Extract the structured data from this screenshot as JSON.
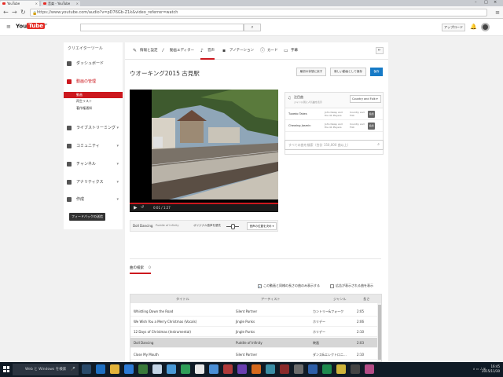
{
  "browser": {
    "tabs": [
      {
        "label": "YouTube"
      },
      {
        "label": "音楽 - YouTube"
      }
    ],
    "url": "https://www.youtube.com/audio?v=pD76Gb-Z1k&video_referrer=watch"
  },
  "header": {
    "logo_you": "You",
    "logo_tube": "Tube",
    "logo_region": "JP",
    "upload_label": "アップロード"
  },
  "sidebar": {
    "title": "クリエイターツール",
    "items": [
      {
        "label": "ダッシュボード"
      },
      {
        "label": "動画の管理"
      },
      {
        "label": "ライブストリーミング"
      },
      {
        "label": "コミュニティ"
      },
      {
        "label": "チャンネル"
      },
      {
        "label": "アナリティクス"
      },
      {
        "label": "作成"
      }
    ],
    "subitems": [
      {
        "label": "動画"
      },
      {
        "label": "再生リスト"
      },
      {
        "label": "著作権通知"
      }
    ],
    "feedback_label": "フィードバックの送信"
  },
  "editor": {
    "tabs": [
      {
        "label": "情報と設定"
      },
      {
        "label": "動画エディター"
      },
      {
        "label": "音声"
      },
      {
        "label": "アノテーション"
      },
      {
        "label": "カード"
      },
      {
        "label": "字幕"
      }
    ],
    "video_title": "ウオーキング2015 古見駅",
    "buttons": {
      "revert": "最初の状態に戻す",
      "save_new": "新しい動画として保存",
      "save": "保存"
    },
    "time_display": "0:01 / 1:27",
    "track": {
      "name": "Doll Dancing",
      "artist": "Puddle of Infinity",
      "balance_label": "オリジナル音声を優先",
      "position_button": "音声の位置を決め"
    }
  },
  "track_panel": {
    "header_label": "注目曲",
    "header_sub": "ジャンル別に人気曲を表示",
    "genre_selected": "Country and Folk",
    "rows": [
      {
        "name": "Tuxedo Takes",
        "artist": "John Deley and the 41 Players",
        "genre": "Country and Folk",
        "add": "追加"
      },
      {
        "name": "Chewing Jasmin",
        "artist": "John Deley and the 41 Players",
        "genre": "Country and Folk",
        "add": "追加"
      }
    ],
    "search_placeholder": "すべての曲を検索（合計 150,000 曲以上）"
  },
  "library": {
    "tab_label": "曲の検索",
    "tab_badge": "0",
    "checkbox1_label": "この動画と同様の長さの曲のみ表示する",
    "checkbox2_label": "広告が表示される曲を表示",
    "columns": [
      "タイトル",
      "アーティスト",
      "ジャンル",
      "長さ"
    ],
    "rows": [
      {
        "title": "Whistling Down the Road",
        "artist": "Silent Partner",
        "genre": "カントリー&フォーク",
        "length": "2:05"
      },
      {
        "title": "We Wish You a Merry Christmas (Vocals)",
        "artist": "Jingle Punks",
        "genre": "ホリデー",
        "length": "2:06"
      },
      {
        "title": "12 Days of Christmas (Instrumental)",
        "artist": "Jingle Punks",
        "genre": "ホリデー",
        "length": "2:10"
      },
      {
        "title": "Doll Dancing",
        "artist": "Puddle of Infinity",
        "genre": "映画",
        "length": "2:03"
      },
      {
        "title": "Close My Mouth",
        "artist": "Silent Partner",
        "genre": "ダンス&エレクトロニ...",
        "length": "2:10"
      }
    ]
  },
  "taskbar": {
    "search_placeholder": "Web と Windows を検索",
    "time": "16:45",
    "date": "2015/11/30"
  },
  "colors": {
    "accent_red": "#cc181e",
    "primary_blue": "#167ac6",
    "taskbar_bg": "#101b26"
  }
}
